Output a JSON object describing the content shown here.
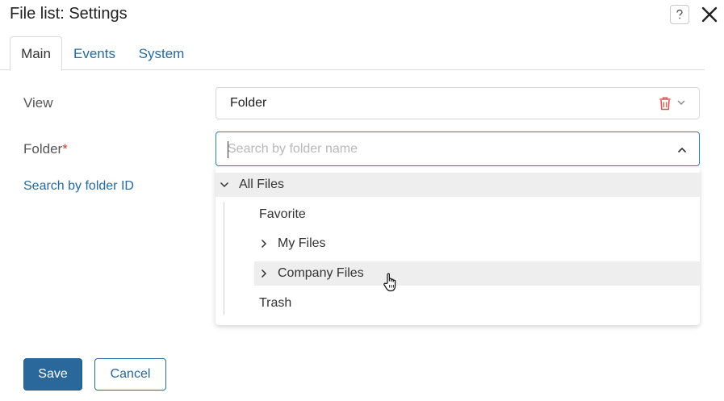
{
  "dialog": {
    "title": "File list: Settings",
    "help_icon": "question-icon",
    "close_icon": "close-icon"
  },
  "tabs": [
    {
      "label": "Main",
      "active": true
    },
    {
      "label": "Events",
      "active": false
    },
    {
      "label": "System",
      "active": false
    }
  ],
  "form": {
    "view_label": "View",
    "view_value": "Folder",
    "folder_label": "Folder",
    "required_mark": "*",
    "search_placeholder": "Search by folder name",
    "search_value": "",
    "search_by_id_link": "Search by folder ID"
  },
  "tree": {
    "root": {
      "label": "All Files",
      "expanded": true
    },
    "children": [
      {
        "label": "Favorite",
        "expandable": false
      },
      {
        "label": "My Files",
        "expandable": true
      },
      {
        "label": "Company Files",
        "expandable": true,
        "hovered": true
      },
      {
        "label": "Trash",
        "expandable": false
      }
    ]
  },
  "buttons": {
    "save": "Save",
    "cancel": "Cancel"
  },
  "colors": {
    "accent": "#2a679a",
    "link": "#276a9e",
    "required": "#d33a2c",
    "delete_icon": "#d9534f",
    "hover_bg": "#eeeeee"
  }
}
